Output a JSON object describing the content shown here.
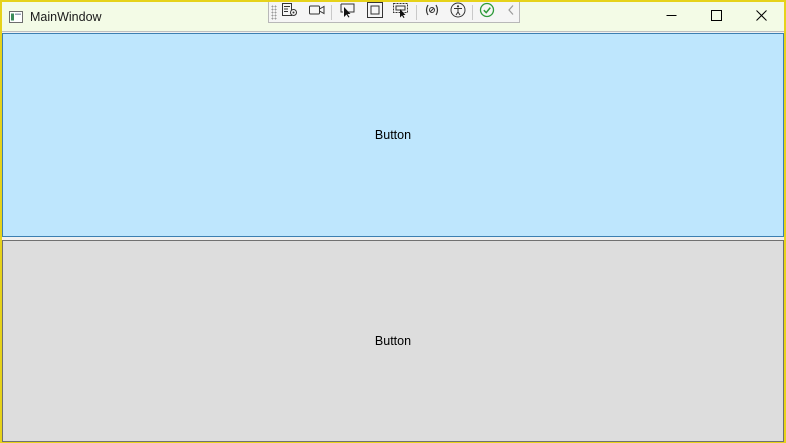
{
  "window": {
    "title": "MainWindow",
    "controls": {
      "minimize_icon": "minimize-icon",
      "maximize_icon": "maximize-icon",
      "close_icon": "close-icon"
    }
  },
  "debug_toolbar": {
    "items": [
      {
        "name": "live-visual-tree-icon"
      },
      {
        "name": "record-icon"
      },
      {
        "name": "select-element-icon"
      },
      {
        "name": "display-layout-adorners-icon"
      },
      {
        "name": "track-focused-element-icon"
      },
      {
        "name": "binding-failures-icon"
      },
      {
        "name": "accessibility-icon"
      },
      {
        "name": "checkmark-icon"
      },
      {
        "name": "collapse-chevron-icon"
      }
    ]
  },
  "buttons": {
    "top_label": "Button",
    "bottom_label": "Button"
  },
  "colors": {
    "window_border": "#e6d21a",
    "titlebar_bg": "#f3fbe6",
    "top_button_bg": "#bee6fd",
    "top_button_border": "#3c7fb1",
    "bottom_button_bg": "#dddddd",
    "bottom_button_border": "#707070"
  }
}
